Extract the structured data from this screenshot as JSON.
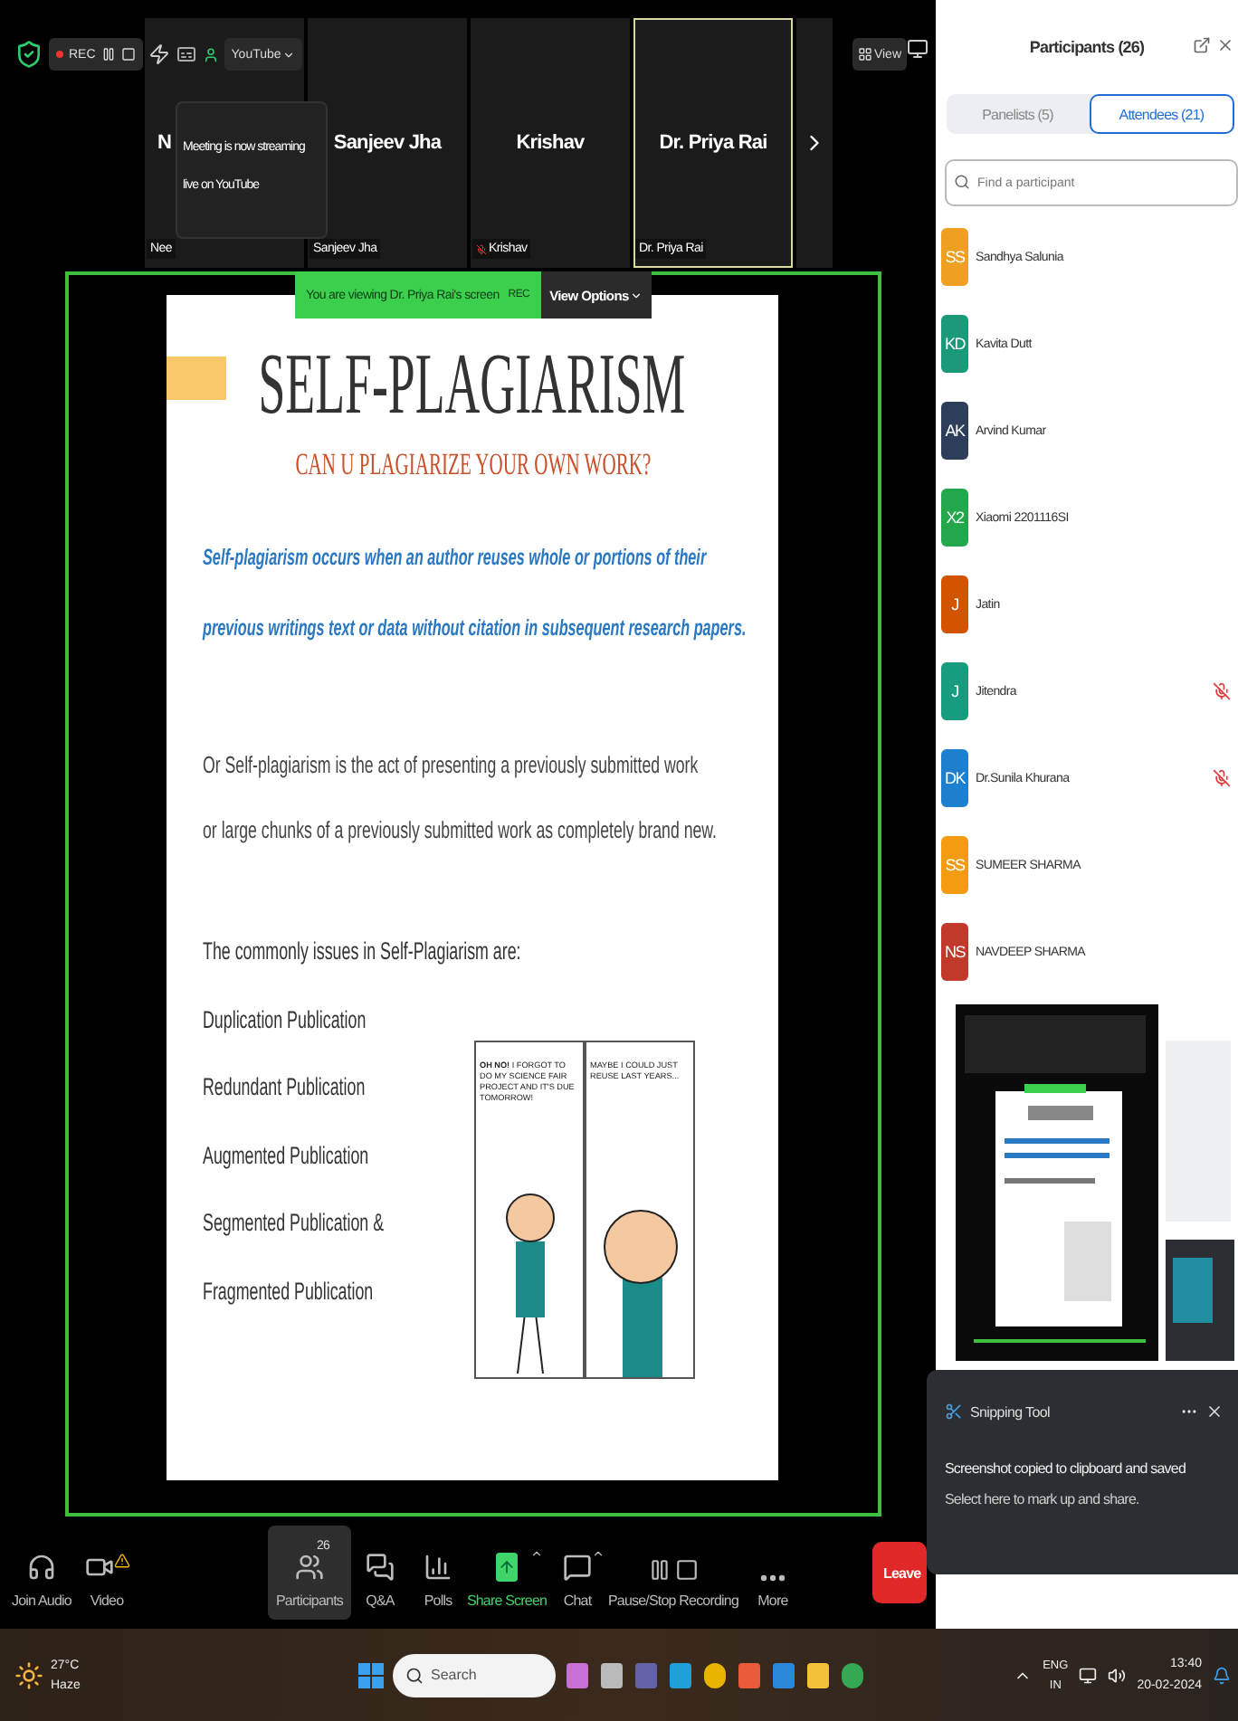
{
  "top_bar": {
    "recording": "REC",
    "streaming_button": "YouTube",
    "view_button": "View"
  },
  "streaming_tooltip": "Meeting is now streaming live on YouTube",
  "video_tiles": [
    {
      "name": "N",
      "label": "Nee",
      "active": false,
      "muted": false
    },
    {
      "name": "Sanjeev Jha",
      "label": "Sanjeev Jha",
      "active": false,
      "muted": false
    },
    {
      "name": "Krishav",
      "label": "Krishav",
      "active": false,
      "muted": true
    },
    {
      "name": "Dr. Priya Rai",
      "label": "Dr. Priya Rai",
      "active": true,
      "muted": false
    }
  ],
  "share_banner": {
    "text": "You are viewing Dr. Priya Rai's screen",
    "recording": "REC",
    "view_options": "View Options"
  },
  "slide": {
    "title": "SELF-PLAGIARISM",
    "subtitle": "CAN U PLAGIARIZE YOUR OWN WORK?",
    "definition_lines": [
      "Self-plagiarism occurs when an author reuses whole or portions of their",
      "previous writings text or data without citation in subsequent research papers."
    ],
    "alternate_lines": [
      "Or Self-plagiarism is the act of presenting a previously submitted work",
      "or large chunks of a previously submitted work as completely brand new."
    ],
    "issues_heading": "The commonly issues in Self-Plagiarism are:",
    "issues": [
      "Duplication Publication",
      "Redundant Publication",
      "Augmented Publication",
      "Segmented Publication &",
      "Fragmented Publication"
    ],
    "comic_panels": [
      {
        "text": "**OH NO!** I FORGOT TO DO MY SCIENCE FAIR PROJECT AND IT'S DUE TOMORROW!"
      },
      {
        "text": "MAYBE I COULD JUST REUSE LAST YEARS..."
      }
    ]
  },
  "toolbar": [
    {
      "kind": "audio",
      "label": "Join Audio",
      "selected": false
    },
    {
      "kind": "video",
      "label": "Video",
      "selected": false
    },
    {
      "kind": "participants",
      "label": "Participants",
      "badge": "26",
      "selected": true
    },
    {
      "kind": "qa",
      "label": "Q&A",
      "selected": false
    },
    {
      "kind": "polls",
      "label": "Polls",
      "selected": false
    },
    {
      "kind": "share",
      "label": "Share Screen",
      "selected": false
    },
    {
      "kind": "chat",
      "label": "Chat",
      "selected": false
    },
    {
      "kind": "recording",
      "label": "Pause/Stop Recording",
      "selected": false
    },
    {
      "kind": "more",
      "label": "More",
      "selected": false
    }
  ],
  "leave_button": "Leave",
  "participants_panel": {
    "title": "Participants (26)",
    "tabs": [
      {
        "label": "Panelists (5)",
        "selected": false
      },
      {
        "label": "Attendees (21)",
        "selected": true
      }
    ],
    "search": {
      "placeholder": "Find a participant"
    },
    "attendees": [
      {
        "initials": "SS",
        "name": "Sandhya Salunia",
        "color": "#f0a020",
        "muted": false
      },
      {
        "initials": "KD",
        "name": "Kavita Dutt",
        "color": "#1a9a78",
        "muted": false
      },
      {
        "initials": "AK",
        "name": "Arvind Kumar",
        "color": "#2c3e5a",
        "muted": false
      },
      {
        "initials": "X2",
        "name": "Xiaomi 2201116SI",
        "color": "#22a84a",
        "muted": false
      },
      {
        "initials": "J",
        "name": "Jatin",
        "color": "#d35400",
        "muted": false
      },
      {
        "initials": "J",
        "name": "Jitendra",
        "color": "#179c80",
        "muted": true
      },
      {
        "initials": "DK",
        "name": "Dr.Sunila Khurana",
        "color": "#1f7fcf",
        "muted": true
      },
      {
        "initials": "SS",
        "name": "SUMEER SHARMA",
        "color": "#f39c12",
        "muted": false
      },
      {
        "initials": "NS",
        "name": "NAVDEEP SHARMA",
        "color": "#c0392b",
        "muted": false
      }
    ]
  },
  "notification": {
    "app": "Snipping Tool",
    "message": "Screenshot copied to clipboard and saved",
    "hint": "Select here to mark up and share."
  },
  "taskbar": {
    "temperature": "27°C",
    "condition": "Haze",
    "search": {
      "placeholder": "Search"
    },
    "language": "ENG",
    "region": "IN",
    "time": "13:40",
    "date": "20-02-2024"
  }
}
